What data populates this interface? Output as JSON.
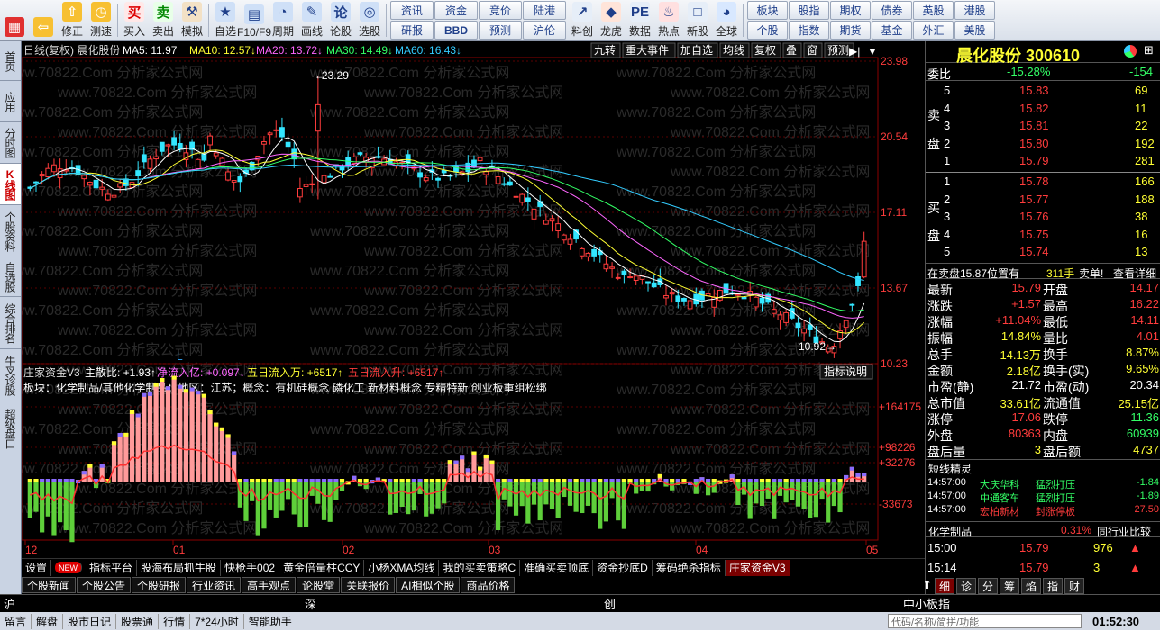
{
  "toolbar": {
    "left_buttons": [
      {
        "label": "",
        "icon": "grid-icon"
      },
      {
        "label": "",
        "icon": "back-arrow-icon"
      },
      {
        "label": "修正",
        "icon": "up-arrow-icon"
      },
      {
        "label": "测速",
        "icon": "stopwatch-icon"
      },
      {
        "label": "买入",
        "icon": "buy-icon"
      },
      {
        "label": "卖出",
        "icon": "sell-icon"
      },
      {
        "label": "模拟",
        "icon": "hammer-icon"
      },
      {
        "label": "自选",
        "icon": "star-icon"
      },
      {
        "label": "F10/F9",
        "icon": "f10-icon"
      },
      {
        "label": "周期",
        "icon": "clock-icon"
      },
      {
        "label": "画线",
        "icon": "pen-icon"
      },
      {
        "label": "论股",
        "icon": "chat-icon"
      },
      {
        "label": "选股",
        "icon": "target-icon"
      }
    ],
    "grid_left": [
      "资讯",
      "资金",
      "竞价",
      "陆港",
      "研报",
      "BBD",
      "预测",
      "沪伦"
    ],
    "mid_buttons": [
      {
        "label": "料创",
        "icon": "chart-icon"
      },
      {
        "label": "龙虎",
        "icon": "dragon-icon"
      },
      {
        "label": "数据",
        "icon": "pe-icon"
      },
      {
        "label": "热点",
        "icon": "hot-icon"
      },
      {
        "label": "新股",
        "icon": "ipo-icon"
      },
      {
        "label": "全球",
        "icon": "globe-icon"
      }
    ],
    "grid_right": [
      "板块",
      "股指",
      "期权",
      "债券",
      "英股",
      "港股",
      "个股",
      "指数",
      "期货",
      "基金",
      "外汇",
      "美股"
    ]
  },
  "left_tabs": [
    "首页",
    "应用",
    "分时图",
    "K线图",
    "个股资料",
    "自选股",
    "综合排名",
    "牛叉诊股",
    "超级盘口"
  ],
  "chart": {
    "header": "日线(复权) 晨化股份",
    "ma": [
      {
        "label": "MA5: 11.97",
        "color": "#ffffff"
      },
      {
        "label": "MA10: 12.57↓",
        "color": "#ffff33"
      },
      {
        "label": "MA20: 13.72↓",
        "color": "#ff66ff"
      },
      {
        "label": "MA30: 14.49↓",
        "color": "#33ff66"
      },
      {
        "label": "MA60: 16.43↓",
        "color": "#33ccff"
      }
    ],
    "top_right_buttons": [
      "九转",
      "重大事件",
      "加自选",
      "均线",
      "复权",
      "叠",
      "窗",
      "预测"
    ],
    "price_labels": [
      "23.98",
      "20.54",
      "17.11",
      "13.67",
      "10.23"
    ],
    "high_label": "23.29",
    "low_label": "10.92",
    "marker_l": "L",
    "indicator_title": "庄家资金V3",
    "indicator_values": [
      {
        "label": "主散比: +1.93↑",
        "color": "#ffffff"
      },
      {
        "label": "净流入亿: +0.097↓",
        "color": "#ff66ff"
      },
      {
        "label": "五日流入万: +6517↑",
        "color": "#ffff33"
      },
      {
        "label": "五日流入升: +6517↑",
        "color": "#ff3c3c"
      }
    ],
    "indicator_btn": "指标说明",
    "sector_text": "板块：化学制品/其他化学制品；地区：江苏；概念：有机硅概念 磷化工 新材料概念 专精特新 创业板重组松绑",
    "indicator_labels": [
      "+164175",
      "+98226",
      "+32276",
      "-33673"
    ],
    "x_labels": [
      "12",
      "01",
      "02",
      "03",
      "04",
      "05"
    ],
    "watermark": "www.70822.Com 分析家公式网"
  },
  "chart_data": {
    "type": "candlestick",
    "x": [
      "12",
      "01",
      "02",
      "03",
      "04",
      "05"
    ],
    "ylim": [
      10.23,
      23.98
    ],
    "high": 23.29,
    "low": 10.92,
    "last_close": 15.79
  },
  "right_panel": {
    "title": "晨化股份 300610",
    "webi": {
      "label": "委比",
      "value": "-15.28%",
      "extra": "-154"
    },
    "sell": [
      {
        "n": "5",
        "p": "15.83",
        "v": "69"
      },
      {
        "n": "4",
        "p": "15.82",
        "v": "11"
      },
      {
        "n": "3",
        "p": "15.81",
        "v": "22"
      },
      {
        "n": "2",
        "p": "15.80",
        "v": "192"
      },
      {
        "n": "1",
        "p": "15.79",
        "v": "281"
      }
    ],
    "buy": [
      {
        "n": "1",
        "p": "15.78",
        "v": "166"
      },
      {
        "n": "2",
        "p": "15.77",
        "v": "188"
      },
      {
        "n": "3",
        "p": "15.76",
        "v": "38"
      },
      {
        "n": "4",
        "p": "15.75",
        "v": "16"
      },
      {
        "n": "5",
        "p": "15.74",
        "v": "13"
      }
    ],
    "sell_side": "卖盘",
    "buy_side": "买盘",
    "sell_chars": [
      "卖",
      "盘"
    ],
    "buy_chars": [
      "买",
      "盘"
    ],
    "notice": {
      "text": "在卖盘15.87位置有",
      "vol": "311手",
      "tag": "卖单!",
      "link": "查看详细"
    },
    "stats": [
      {
        "l1": "最新",
        "v1": "15.79",
        "l2": "开盘",
        "v2": "14.17",
        "c1": "red",
        "c2": "red"
      },
      {
        "l1": "涨跌",
        "v1": "+1.57",
        "l2": "最高",
        "v2": "16.22",
        "c1": "red",
        "c2": "red"
      },
      {
        "l1": "涨幅",
        "v1": "+11.04%",
        "l2": "最低",
        "v2": "14.11",
        "c1": "red",
        "c2": "red"
      },
      {
        "l1": "振幅",
        "v1": "14.84%",
        "l2": "量比",
        "v2": "4.01",
        "c1": "yel",
        "c2": "red"
      },
      {
        "l1": "总手",
        "v1": "14.13万",
        "l2": "换手",
        "v2": "8.87%",
        "c1": "yel",
        "c2": "yel"
      },
      {
        "l1": "金额",
        "v1": "2.18亿",
        "l2": "换手(实)",
        "v2": "9.65%",
        "c1": "yel",
        "c2": "yel"
      },
      {
        "l1": "市盈(静)",
        "v1": "21.72",
        "l2": "市盈(动)",
        "v2": "20.34",
        "c1": "wht",
        "c2": "wht"
      },
      {
        "l1": "总市值",
        "v1": "33.61亿",
        "l2": "流通值",
        "v2": "25.15亿",
        "c1": "yel",
        "c2": "yel"
      },
      {
        "l1": "涨停",
        "v1": "17.06",
        "l2": "跌停",
        "v2": "11.36",
        "c1": "red",
        "c2": "grn"
      },
      {
        "l1": "外盘",
        "v1": "80363",
        "l2": "内盘",
        "v2": "60939",
        "c1": "red",
        "c2": "grn"
      },
      {
        "l1": "盘后量",
        "v1": "3",
        "l2": "盘后额",
        "v2": "4737",
        "c1": "yel",
        "c2": "yel"
      }
    ],
    "short_title": "短线精灵",
    "short_rows": [
      {
        "t": "14:57:00",
        "n": "大庆华科",
        "a": "猛烈打压",
        "v": "-1.84",
        "c": "grn"
      },
      {
        "t": "14:57:00",
        "n": "中通客车",
        "a": "猛烈打压",
        "v": "-1.89",
        "c": "grn"
      },
      {
        "t": "14:57:00",
        "n": "宏柏新材",
        "a": "封涨停板",
        "v": "27.50",
        "c": "red"
      }
    ],
    "sector": {
      "name": "化学制品",
      "pct": "0.31%",
      "link": "同行业比较"
    },
    "ticks": [
      {
        "t": "15:00",
        "p": "15.79",
        "v": "976"
      },
      {
        "t": "15:14",
        "p": "15.79",
        "v": "3"
      }
    ],
    "bottom_tabs": [
      "细",
      "诊",
      "分",
      "筹",
      "焰",
      "指",
      "财"
    ]
  },
  "bottom_tabs": [
    "设置",
    "NEW",
    "指标平台",
    "股海布局抓牛股",
    "快枪手002",
    "黄金倍量柱CCY",
    "小杨XMA均线",
    "我的买卖策略C",
    "准确买卖顶底",
    "资金抄底D",
    "筹码绝杀指标",
    "庄家资金V3"
  ],
  "bottom_tabs2": [
    "个股新闻",
    "个股公告",
    "个股研报",
    "行业资讯",
    "高手观点",
    "论股堂",
    "关联报价",
    "AI相似个股",
    "商品价格"
  ],
  "status": {
    "items": [
      "沪",
      "深",
      "创"
    ],
    "right": "中小板指"
  },
  "status2": {
    "items": [
      "留言",
      "解盘",
      "股市日记",
      "股票通",
      "行情",
      "7*24小时",
      "智能助手"
    ],
    "search": "代码/名称/简拼/功能",
    "time": "01:52:30"
  }
}
